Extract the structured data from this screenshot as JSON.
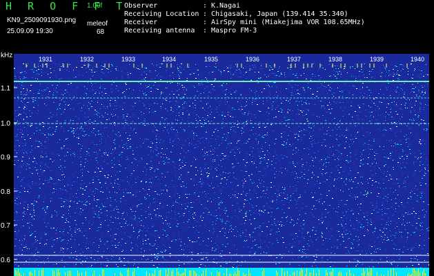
{
  "header": {
    "title": "H R O F F T",
    "version": "1.00f",
    "filename": "KN9_2509091930.png",
    "timestamp": "25.09.09 19:30",
    "meleof_label": "meleof",
    "meleof_value": "68"
  },
  "metadata": [
    {
      "key": "Observer",
      "value": "K.Nagai"
    },
    {
      "key": "Receiving Location",
      "value": "Chigasaki, Japan (139.414 35.340)"
    },
    {
      "key": "Receiver",
      "value": "AirSpy mini (Miakejima VOR 108.65MHz)"
    },
    {
      "key": "Receiving antenna",
      "value": "Maspro FM-3"
    }
  ],
  "spectrogram": {
    "y_unit": "kHz",
    "y_ticks": [
      "1.1",
      "1.0",
      "0.9",
      "0.8",
      "0.7",
      "0.6"
    ],
    "x_ticks": [
      "1931",
      "1932",
      "1933",
      "1934",
      "1935",
      "1936",
      "1937",
      "1938",
      "1939",
      "1940"
    ],
    "background_color": "#1a2a9c",
    "noise_colors": [
      "#2c56e0",
      "#00a8ff",
      "#00e0ff",
      "#80ffe0",
      "#ffffff"
    ],
    "signal_color": "#ffff00",
    "floor_color": "#00e4ff"
  }
}
